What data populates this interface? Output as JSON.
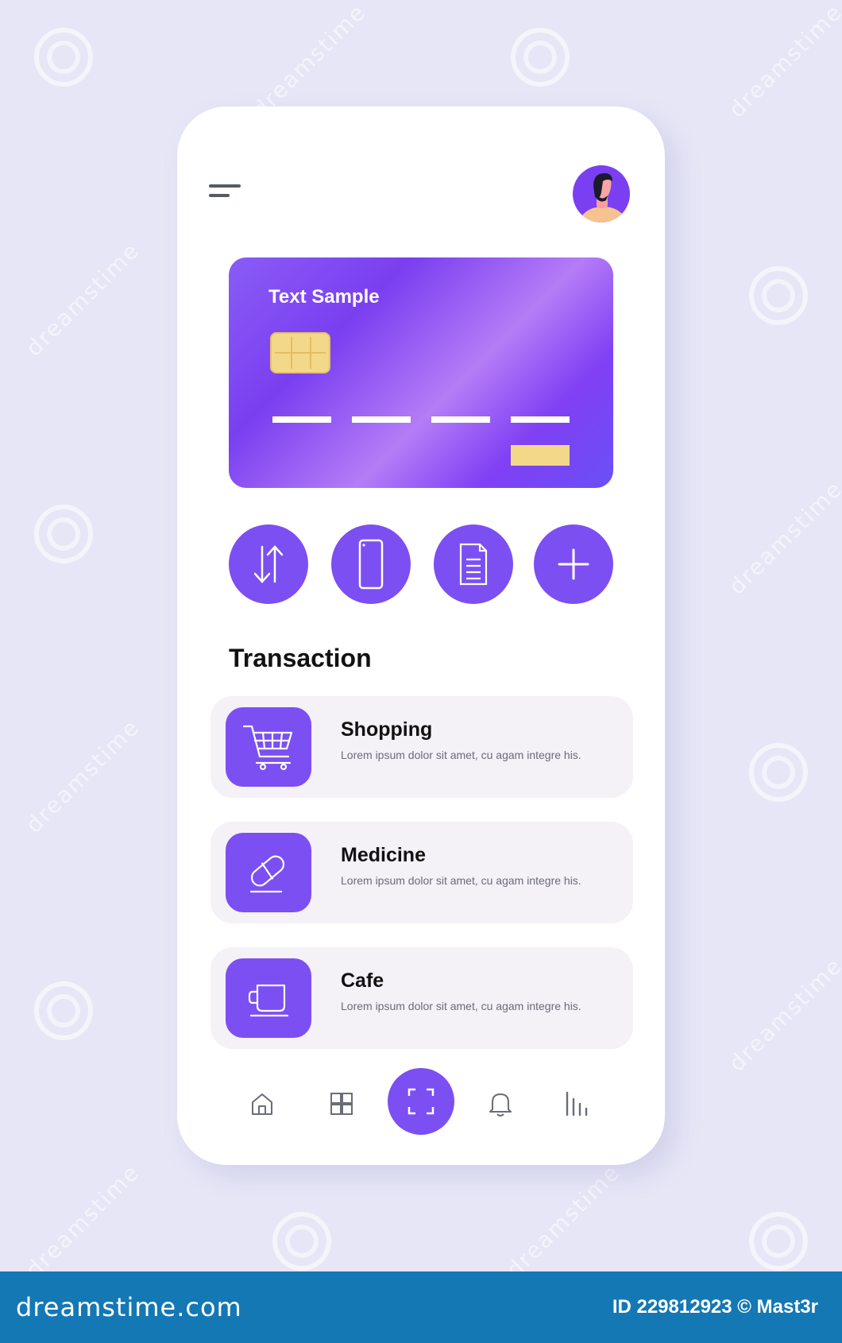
{
  "card": {
    "title": "Text Sample"
  },
  "section": {
    "title": "Transaction"
  },
  "transactions": [
    {
      "name": "Shopping",
      "description": "Lorem ipsum dolor sit amet, cu agam integre his.",
      "icon": "shopping-cart-icon"
    },
    {
      "name": "Medicine",
      "description": "Lorem ipsum dolor sit amet, cu agam integre his.",
      "icon": "pill-icon"
    },
    {
      "name": "Cafe",
      "description": "Lorem ipsum dolor sit amet, cu agam integre his.",
      "icon": "coffee-cup-icon"
    }
  ],
  "quick_actions": [
    "transfer-icon",
    "phone-icon",
    "document-icon",
    "plus-icon"
  ],
  "bottom_nav": [
    "home-icon",
    "grid-icon",
    "scan-icon",
    "bell-icon",
    "stats-icon"
  ],
  "watermark": {
    "text": "dreamstime",
    "logo": "dreamstime.com",
    "id_label": "ID 229812923 © Mast3r"
  },
  "colors": {
    "accent": "#7c4ff3",
    "background": "#e6e6f7",
    "card_gradient_start": "#8a5cf6",
    "chip": "#f3d88a",
    "list_bg": "#f4f1f7",
    "footer": "#1478b4"
  }
}
